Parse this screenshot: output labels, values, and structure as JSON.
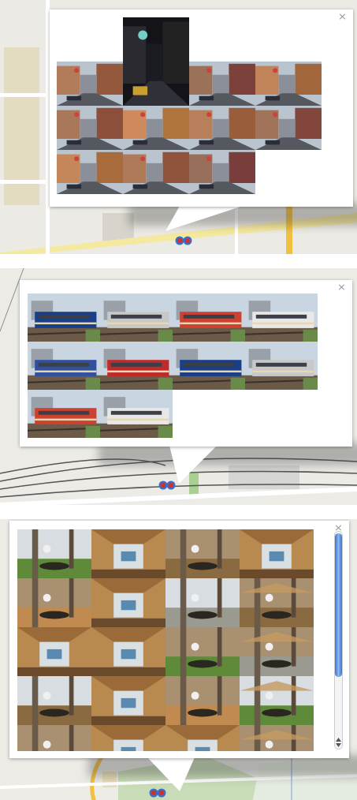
{
  "panels": [
    {
      "close": "×",
      "scrollable": false,
      "photos": [
        {
          "kind": "empty"
        },
        {
          "kind": "tall-picture"
        },
        {
          "kind": "empty"
        },
        {
          "kind": "empty"
        },
        {
          "kind": "picture"
        },
        {
          "kind": "picture"
        },
        {
          "kind": "picture"
        },
        {
          "kind": "picture"
        },
        {
          "kind": "picture"
        },
        {
          "kind": "picture"
        },
        {
          "kind": "picture"
        },
        {
          "kind": "picture"
        },
        {
          "kind": "picture"
        },
        {
          "kind": "picture"
        }
      ]
    },
    {
      "close": "×",
      "scrollable": false,
      "photos": [
        {
          "kind": "picture"
        },
        {
          "kind": "picture"
        },
        {
          "kind": "picture"
        },
        {
          "kind": "picture"
        },
        {
          "kind": "picture"
        },
        {
          "kind": "picture"
        },
        {
          "kind": "picture"
        },
        {
          "kind": "picture"
        },
        {
          "kind": "picture"
        },
        {
          "kind": "picture"
        }
      ]
    },
    {
      "close": "×",
      "scrollable": true,
      "photos": [
        {
          "kind": "picture"
        },
        {
          "kind": "picture"
        },
        {
          "kind": "picture"
        },
        {
          "kind": "picture"
        },
        {
          "kind": "picture"
        },
        {
          "kind": "picture"
        },
        {
          "kind": "picture"
        },
        {
          "kind": "picture"
        },
        {
          "kind": "picture"
        },
        {
          "kind": "picture"
        },
        {
          "kind": "picture"
        },
        {
          "kind": "picture"
        },
        {
          "kind": "picture"
        },
        {
          "kind": "picture"
        },
        {
          "kind": "picture"
        },
        {
          "kind": "picture"
        },
        {
          "kind": "picture"
        },
        {
          "kind": "picture"
        },
        {
          "kind": "picture"
        },
        {
          "kind": "picture"
        }
      ]
    }
  ]
}
